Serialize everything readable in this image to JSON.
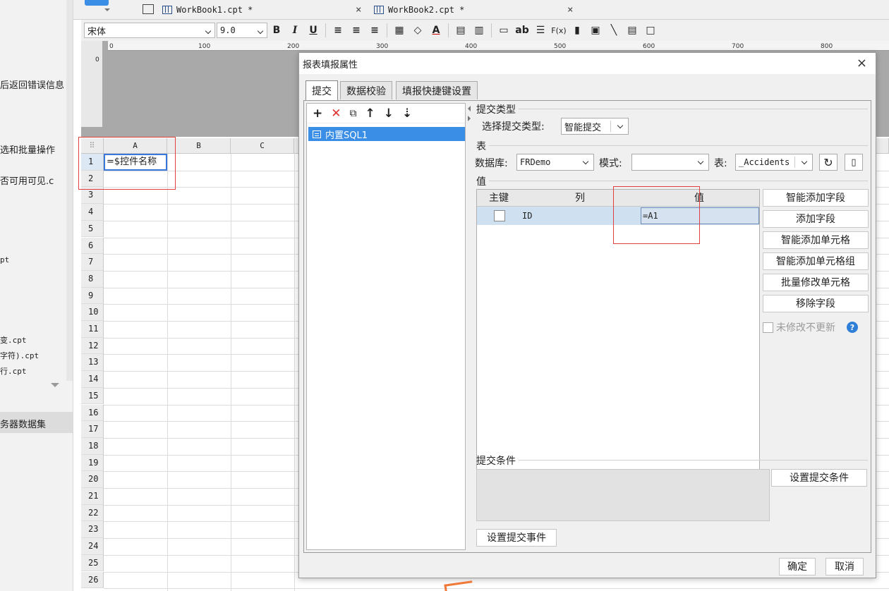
{
  "left_panel": {
    "items": [
      {
        "text": "后返回错误信息",
        "mono": false
      },
      {
        "text": "选和批量操作",
        "mono": false
      },
      {
        "text": "否可用可见.c",
        "mono": false
      },
      {
        "text": "pt",
        "mono": true
      },
      {
        "text": "变.cpt",
        "mono": true
      },
      {
        "text": "字符).cpt",
        "mono": true
      },
      {
        "text": "行.cpt",
        "mono": true
      },
      {
        "text": "务器数据集",
        "mono": false
      }
    ]
  },
  "tabs": [
    {
      "label": "WorkBook1.cpt *",
      "close": "×"
    },
    {
      "label": "WorkBook2.cpt *",
      "close": "×"
    }
  ],
  "toolbar": {
    "font": "宋体",
    "size": "9.0",
    "bold": "B",
    "italic": "I",
    "underline": "U",
    "text_ab": "ab",
    "formula": "F(x)"
  },
  "ruler": {
    "ticks": [
      "0",
      "100",
      "200",
      "300",
      "400",
      "500",
      "600",
      "700",
      "800"
    ]
  },
  "grid": {
    "columns": [
      "A",
      "B",
      "C"
    ],
    "rows": [
      "1",
      "2",
      "3",
      "4",
      "5",
      "6",
      "7",
      "8",
      "9",
      "10",
      "11",
      "12",
      "13",
      "14",
      "15",
      "16",
      "17",
      "18",
      "19",
      "20",
      "21",
      "22",
      "23",
      "24",
      "25",
      "26"
    ],
    "a1_value": "=$控件名称"
  },
  "dialog": {
    "title": "报表填报属性",
    "close": "×",
    "tabs": [
      "提交",
      "数据校验",
      "填报快捷键设置"
    ],
    "sql_item": "内置SQL1",
    "submit_type_group": "提交类型",
    "submit_type_label": "选择提交类型:",
    "submit_type_value": "智能提交",
    "table_group": "表",
    "db_label": "数据库:",
    "db_value": "FRDemo",
    "schema_label": "模式:",
    "schema_value": "",
    "table_label": "表:",
    "table_value": "_Accidents",
    "value_group": "值",
    "value_table": {
      "headers": [
        "主键",
        "列",
        "值"
      ],
      "rows": [
        {
          "key": false,
          "column": "ID",
          "value": "=A1"
        }
      ]
    },
    "side_buttons": [
      "智能添加字段",
      "添加字段",
      "智能添加单元格",
      "智能添加单元格组",
      "批量修改单元格",
      "移除字段"
    ],
    "no_update_label": "未修改不更新",
    "help_icon": "?",
    "condition_group": "提交条件",
    "set_condition_button": "设置提交条件",
    "set_event_button": "设置提交事件",
    "ok_button": "确定",
    "cancel_button": "取消"
  }
}
